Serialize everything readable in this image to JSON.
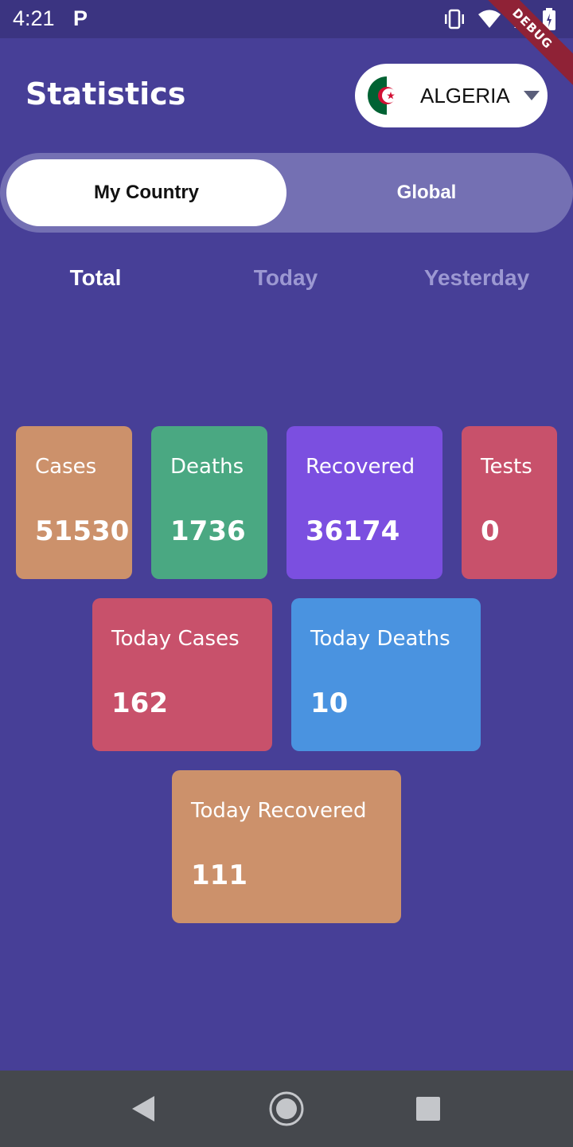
{
  "status_bar": {
    "time": "4:21",
    "notification_icon": "P",
    "icons": [
      "vibrate-icon",
      "wifi-icon",
      "signal-icon",
      "battery-icon"
    ]
  },
  "debug_banner": "DEBUG",
  "header": {
    "title": "Statistics"
  },
  "country_picker": {
    "country": "ALGERIA",
    "flag": "algeria-flag-icon"
  },
  "scope_toggle": {
    "options": [
      "My Country",
      "Global"
    ],
    "selected": "My Country"
  },
  "period_tabs": {
    "items": [
      "Total",
      "Today",
      "Yesterday"
    ],
    "selected": "Total"
  },
  "stats": [
    {
      "label": "Cases",
      "value": "51530",
      "color": "#cc916b"
    },
    {
      "label": "Deaths",
      "value": "1736",
      "color": "#4aa882"
    },
    {
      "label": "Recovered",
      "value": "36174",
      "color": "#7b4fe0"
    },
    {
      "label": "Tests",
      "value": "0",
      "color": "#c8516b"
    },
    {
      "label": "Today Cases",
      "value": "162",
      "color": "#c8516b"
    },
    {
      "label": "Today Deaths",
      "value": "10",
      "color": "#4a93e0"
    },
    {
      "label": "Today Recovered",
      "value": "111",
      "color": "#cc916b"
    }
  ],
  "colors": {
    "background": "#473f97",
    "statusbar": "#3b3481",
    "toggle_track": "#7470b3",
    "tab_inactive": "#9c98d2",
    "navbar": "#45484d"
  },
  "nav_bar": {
    "buttons": [
      "back-icon",
      "home-icon",
      "recents-icon"
    ]
  }
}
